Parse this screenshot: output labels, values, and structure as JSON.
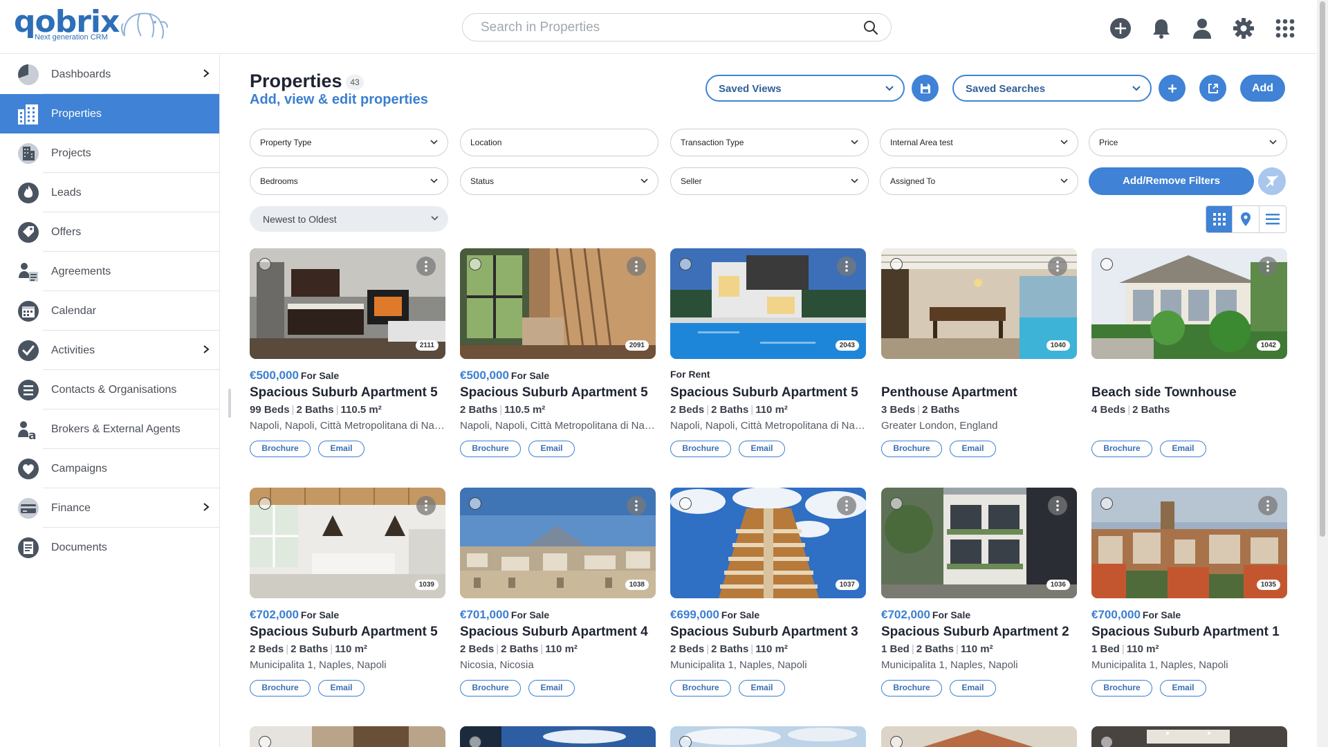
{
  "app": {
    "logo_text": "qobrix",
    "logo_tagline": "Next generation CRM",
    "search_placeholder": "Search in Properties"
  },
  "topbar_icons": [
    "add-circle-icon",
    "bell-icon",
    "user-icon",
    "gear-icon",
    "apps-grid-icon"
  ],
  "sidebar": {
    "items": [
      {
        "label": "Dashboards",
        "icon": "pie-chart-icon",
        "has_submenu": true
      },
      {
        "label": "Properties",
        "icon": "building-icon",
        "active": true
      },
      {
        "label": "Projects",
        "icon": "projects-icon"
      },
      {
        "label": "Leads",
        "icon": "flame-icon"
      },
      {
        "label": "Offers",
        "icon": "tag-icon"
      },
      {
        "label": "Agreements",
        "icon": "agreements-icon"
      },
      {
        "label": "Calendar",
        "icon": "calendar-icon"
      },
      {
        "label": "Activities",
        "icon": "check-circle-icon",
        "has_submenu": true
      },
      {
        "label": "Contacts & Organisations",
        "icon": "contacts-icon"
      },
      {
        "label": "Brokers & External Agents",
        "icon": "broker-icon"
      },
      {
        "label": "Campaigns",
        "icon": "heart-icon"
      },
      {
        "label": "Finance",
        "icon": "finance-icon",
        "has_submenu": true
      },
      {
        "label": "Documents",
        "icon": "documents-icon"
      }
    ]
  },
  "header": {
    "title": "Properties",
    "count": "43",
    "subtitle": "Add, view & edit properties",
    "saved_views": "Saved Views",
    "saved_searches": "Saved Searches",
    "add_label": "Add"
  },
  "filters": {
    "row1": [
      "Property Type",
      "Location",
      "Transaction Type",
      "Internal Area test",
      "Price"
    ],
    "row2": [
      "Bedrooms",
      "Status",
      "Seller",
      "Assigned To"
    ],
    "add_remove_label": "Add/Remove Filters",
    "sort_value": "Newest to Oldest"
  },
  "card_buttons": {
    "brochure": "Brochure",
    "email": "Email"
  },
  "cards": [
    {
      "price": "€500,000",
      "txn": "For Sale",
      "title": "Spacious Suburb Apartment 5",
      "specs": [
        "99 Beds",
        "2 Baths",
        "110.5 m²"
      ],
      "location": "Napoli, Napoli, Città Metropolitana di Napoli",
      "id": "2111",
      "scene": "kitchen"
    },
    {
      "price": "€500,000",
      "txn": "For Sale",
      "title": "Spacious Suburb Apartment 5",
      "specs": [
        "2 Baths",
        "110.5 m²"
      ],
      "location": "Napoli, Napoli, Città Metropolitana di Napoli",
      "id": "2091",
      "scene": "wood-interior"
    },
    {
      "price": "",
      "txn": "For Rent",
      "title": "Spacious Suburb Apartment 5",
      "specs": [
        "2 Beds",
        "2 Baths",
        "110 m²"
      ],
      "location": "Napoli, Napoli, Città Metropolitana di Napoli",
      "id": "2043",
      "scene": "pool-villa"
    },
    {
      "price": "",
      "txn": "",
      "title": "Penthouse Apartment",
      "specs": [
        "3 Beds",
        "2 Baths"
      ],
      "location": "Greater London, England",
      "id": "1040",
      "scene": "terrace-pool"
    },
    {
      "price": "",
      "txn": "",
      "title": "Beach side Townhouse",
      "specs": [
        "4 Beds",
        "2 Baths"
      ],
      "location": "",
      "id": "1042",
      "scene": "garden-house"
    },
    {
      "price": "€702,000",
      "txn": "For Sale",
      "title": "Spacious Suburb Apartment 5",
      "specs": [
        "2 Beds",
        "2 Baths",
        "110 m²"
      ],
      "location": "Municipalita 1, Naples, Napoli",
      "id": "1039",
      "scene": "white-kitchen"
    },
    {
      "price": "€701,000",
      "txn": "For Sale",
      "title": "Spacious Suburb Apartment 4",
      "specs": [
        "2 Beds",
        "2 Baths",
        "110 m²"
      ],
      "location": "Nicosia, Nicosia",
      "id": "1038",
      "scene": "city-view"
    },
    {
      "price": "€699,000",
      "txn": "For Sale",
      "title": "Spacious Suburb Apartment 3",
      "specs": [
        "2 Beds",
        "2 Baths",
        "110 m²"
      ],
      "location": "Municipalita 1, Naples, Napoli",
      "id": "1037",
      "scene": "facade-sky"
    },
    {
      "price": "€702,000",
      "txn": "For Sale",
      "title": "Spacious Suburb Apartment 2",
      "specs": [
        "1 Bed",
        "2 Baths",
        "110 m²"
      ],
      "location": "Municipalita 1, Naples, Napoli",
      "id": "1036",
      "scene": "modern-building"
    },
    {
      "price": "€700,000",
      "txn": "For Sale",
      "title": "Spacious Suburb Apartment 1",
      "specs": [
        "1 Bed",
        "110 m²"
      ],
      "location": "Municipalita 1, Naples, Napoli",
      "id": "1035",
      "scene": "dense-city"
    }
  ]
}
